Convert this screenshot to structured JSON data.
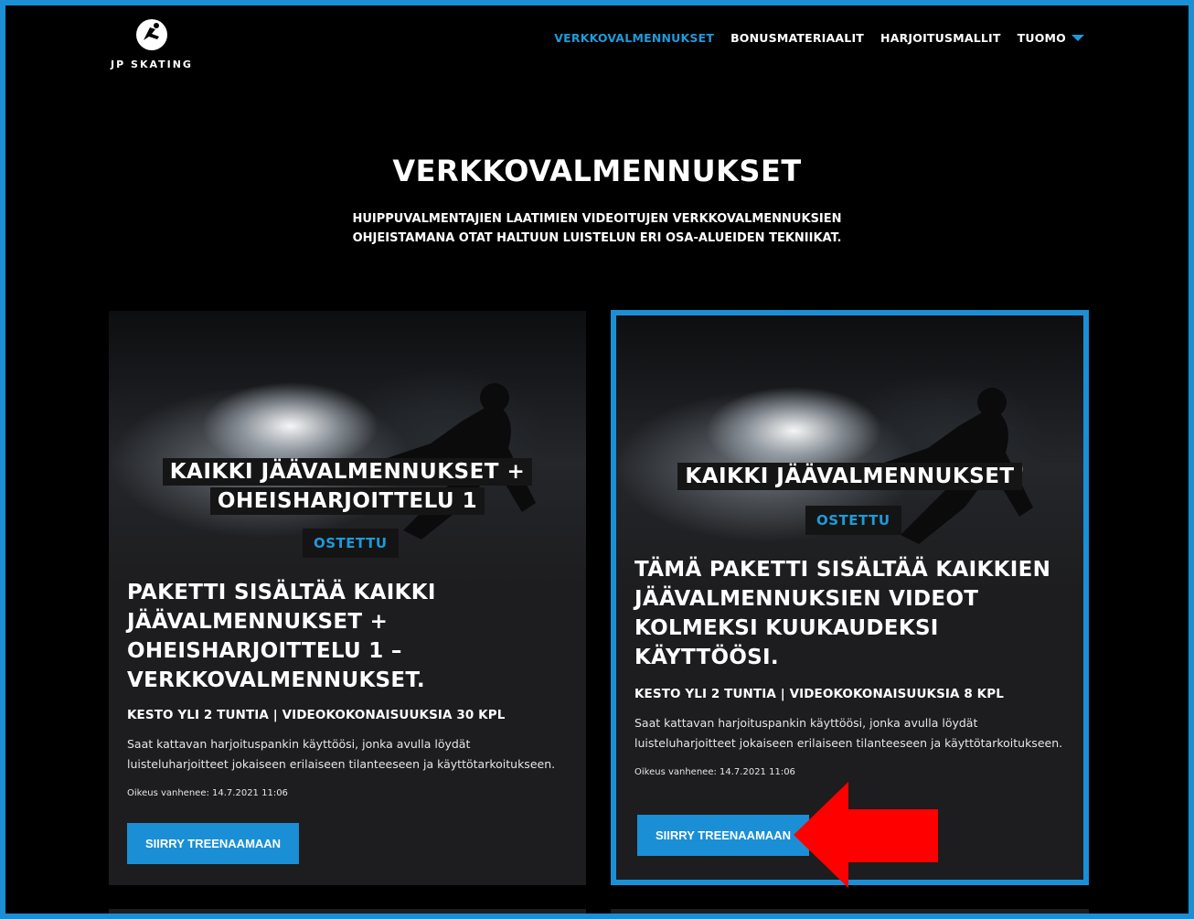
{
  "brand": {
    "name": "JP SKATING"
  },
  "nav": {
    "items": [
      {
        "label": "VERKKOVALMENNUKSET",
        "active": true
      },
      {
        "label": "BONUSMATERIAALIT",
        "active": false
      },
      {
        "label": "HARJOITUSMALLIT",
        "active": false
      }
    ],
    "user": "TUOMO"
  },
  "page": {
    "title": "VERKKOVALMENNUKSET",
    "subtitle_line1": "HUIPPUVALMENTAJIEN LAATIMIEN VIDEOITUJEN VERKKOVALMENNUKSIEN",
    "subtitle_line2": "OHJEISTAMANA OTAT HALTUUN LUISTELUN ERI OSA-ALUEIDEN TEKNIIKAT."
  },
  "cards": [
    {
      "title_line1": "KAIKKI JÄÄVALMENNUKSET +",
      "title_line2": "OHEISHARJOITTELU 1",
      "status": "OSTETTU",
      "heading": "PAKETTI SISÄLTÄÄ KAIKKI JÄÄVALMENNUKSET + OHEISHARJOITTELU 1 – VERKKOVALMENNUKSET.",
      "meta": "KESTO YLI 2 TUNTIA | VIDEOKOKONAISUUKSIA 30 KPL",
      "description": "Saat kattavan harjoituspankin käyttöösi, jonka avulla löydät luisteluharjoitteet jokaiseen erilaiseen tilanteeseen ja käyttötarkoitukseen.",
      "expiry": "Oikeus vanhenee: 14.7.2021 11:06",
      "cta": "SIIRRY TREENAAMAAN",
      "highlighted": false
    },
    {
      "title_line1": "KAIKKI JÄÄVALMENNUKSET",
      "title_line2": "",
      "status": "OSTETTU",
      "heading": "TÄMÄ PAKETTI SISÄLTÄÄ KAIKKIEN JÄÄVALMENNUKSIEN VIDEOT KOLMEKSI KUUKAUDEKSI KÄYTTÖÖSI.",
      "meta": "KESTO YLI 2 TUNTIA | VIDEOKOKONAISUUKSIA 8 KPL",
      "description": "Saat kattavan harjoituspankin käyttöösi, jonka avulla löydät luisteluharjoitteet jokaiseen erilaiseen tilanteeseen ja käyttötarkoitukseen.",
      "expiry": "Oikeus vanhenee: 14.7.2021 11:06",
      "cta": "SIIRRY TREENAAMAAN",
      "highlighted": true
    }
  ],
  "colors": {
    "accent": "#1a8fd6",
    "arrow": "#ff0000",
    "card_bg": "#1d1d1f",
    "page_bg": "#000000"
  }
}
